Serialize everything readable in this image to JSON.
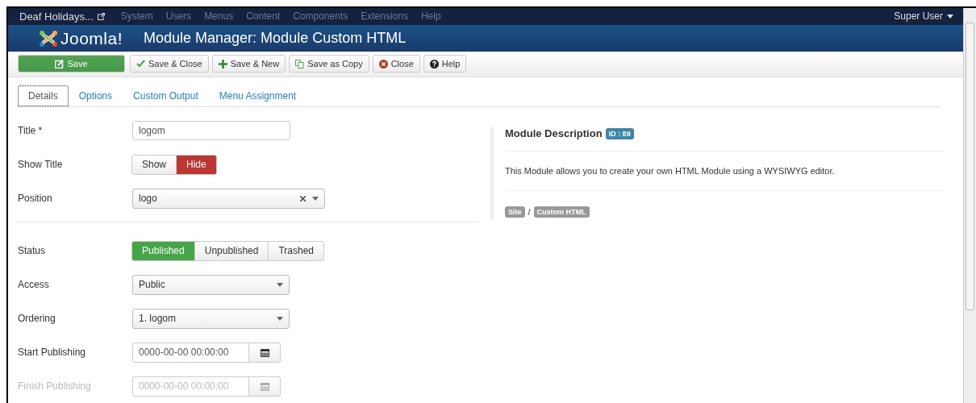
{
  "topbar": {
    "site": "Deaf Holidays...",
    "menu": [
      "System",
      "Users",
      "Menus",
      "Content",
      "Components",
      "Extensions",
      "Help"
    ],
    "user": "Super User"
  },
  "header": {
    "logo": "Joomla!",
    "title": "Module Manager: Module Custom HTML"
  },
  "toolbar": [
    {
      "kind": "save",
      "label": "Save"
    },
    {
      "kind": "check",
      "label": "Save & Close"
    },
    {
      "kind": "plus",
      "label": "Save & New"
    },
    {
      "kind": "copy",
      "label": "Save as Copy"
    },
    {
      "kind": "close",
      "label": "Close"
    },
    {
      "kind": "help",
      "label": "Help"
    }
  ],
  "tabs": [
    {
      "label": "Details",
      "selected": true
    },
    {
      "label": "Options",
      "selected": false
    },
    {
      "label": "Custom Output",
      "selected": false
    },
    {
      "label": "Menu Assignment",
      "selected": false
    }
  ],
  "fields": [
    {
      "kind": "text",
      "label": "Title *",
      "value": "logom"
    },
    {
      "kind": "toggle-danger",
      "label": "Show Title",
      "options": [
        {
          "label": "Show",
          "selected": false
        },
        {
          "label": "Hide",
          "selected": true
        }
      ]
    },
    {
      "kind": "chosen",
      "label": "Position",
      "value": "logo"
    },
    {
      "kind": "divider"
    },
    {
      "kind": "toggle-success",
      "label": "Status",
      "options": [
        {
          "label": "Published",
          "selected": true
        },
        {
          "label": "Unpublished",
          "selected": false
        },
        {
          "label": "Trashed",
          "selected": false
        }
      ]
    },
    {
      "kind": "select",
      "label": "Access",
      "value": "Public"
    },
    {
      "kind": "select",
      "label": "Ordering",
      "value": "1. logom"
    },
    {
      "kind": "date",
      "label": "Start Publishing",
      "value": "0000-00-00 00:00:00",
      "disabled": false
    },
    {
      "kind": "date",
      "label": "Finish Publishing",
      "value": "0000-00-00 00:00:00",
      "disabled": true
    }
  ],
  "description": {
    "title": "Module Description",
    "id_badge": "ID : 89",
    "text": "This Module allows you to create your own HTML Module using a WYSIWYG editor.",
    "path": [
      "Site",
      "Custom HTML"
    ],
    "separator": "/"
  }
}
